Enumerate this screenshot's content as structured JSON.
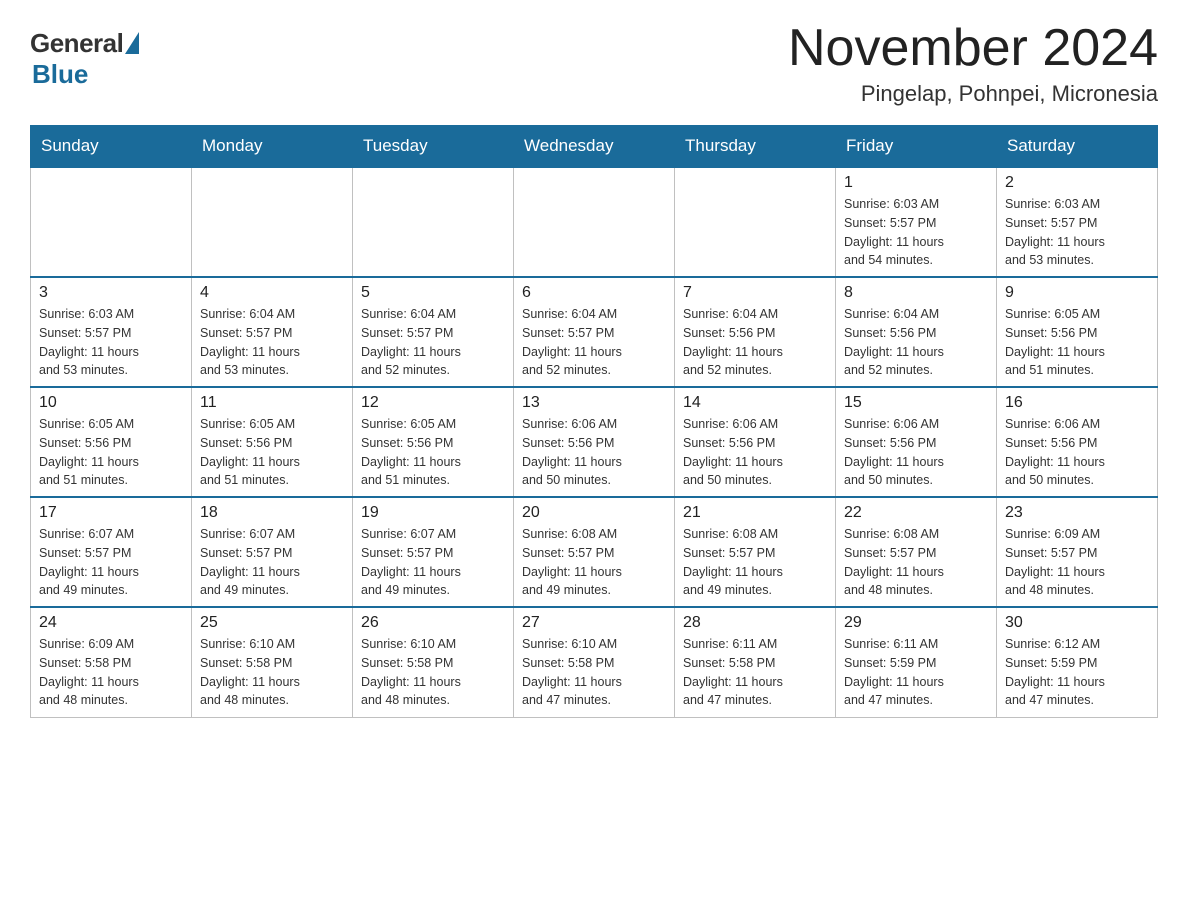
{
  "header": {
    "logo_general": "General",
    "logo_blue": "Blue",
    "month_title": "November 2024",
    "location": "Pingelap, Pohnpei, Micronesia"
  },
  "days_of_week": [
    "Sunday",
    "Monday",
    "Tuesday",
    "Wednesday",
    "Thursday",
    "Friday",
    "Saturday"
  ],
  "weeks": [
    [
      {
        "day": "",
        "info": ""
      },
      {
        "day": "",
        "info": ""
      },
      {
        "day": "",
        "info": ""
      },
      {
        "day": "",
        "info": ""
      },
      {
        "day": "",
        "info": ""
      },
      {
        "day": "1",
        "info": "Sunrise: 6:03 AM\nSunset: 5:57 PM\nDaylight: 11 hours\nand 54 minutes."
      },
      {
        "day": "2",
        "info": "Sunrise: 6:03 AM\nSunset: 5:57 PM\nDaylight: 11 hours\nand 53 minutes."
      }
    ],
    [
      {
        "day": "3",
        "info": "Sunrise: 6:03 AM\nSunset: 5:57 PM\nDaylight: 11 hours\nand 53 minutes."
      },
      {
        "day": "4",
        "info": "Sunrise: 6:04 AM\nSunset: 5:57 PM\nDaylight: 11 hours\nand 53 minutes."
      },
      {
        "day": "5",
        "info": "Sunrise: 6:04 AM\nSunset: 5:57 PM\nDaylight: 11 hours\nand 52 minutes."
      },
      {
        "day": "6",
        "info": "Sunrise: 6:04 AM\nSunset: 5:57 PM\nDaylight: 11 hours\nand 52 minutes."
      },
      {
        "day": "7",
        "info": "Sunrise: 6:04 AM\nSunset: 5:56 PM\nDaylight: 11 hours\nand 52 minutes."
      },
      {
        "day": "8",
        "info": "Sunrise: 6:04 AM\nSunset: 5:56 PM\nDaylight: 11 hours\nand 52 minutes."
      },
      {
        "day": "9",
        "info": "Sunrise: 6:05 AM\nSunset: 5:56 PM\nDaylight: 11 hours\nand 51 minutes."
      }
    ],
    [
      {
        "day": "10",
        "info": "Sunrise: 6:05 AM\nSunset: 5:56 PM\nDaylight: 11 hours\nand 51 minutes."
      },
      {
        "day": "11",
        "info": "Sunrise: 6:05 AM\nSunset: 5:56 PM\nDaylight: 11 hours\nand 51 minutes."
      },
      {
        "day": "12",
        "info": "Sunrise: 6:05 AM\nSunset: 5:56 PM\nDaylight: 11 hours\nand 51 minutes."
      },
      {
        "day": "13",
        "info": "Sunrise: 6:06 AM\nSunset: 5:56 PM\nDaylight: 11 hours\nand 50 minutes."
      },
      {
        "day": "14",
        "info": "Sunrise: 6:06 AM\nSunset: 5:56 PM\nDaylight: 11 hours\nand 50 minutes."
      },
      {
        "day": "15",
        "info": "Sunrise: 6:06 AM\nSunset: 5:56 PM\nDaylight: 11 hours\nand 50 minutes."
      },
      {
        "day": "16",
        "info": "Sunrise: 6:06 AM\nSunset: 5:56 PM\nDaylight: 11 hours\nand 50 minutes."
      }
    ],
    [
      {
        "day": "17",
        "info": "Sunrise: 6:07 AM\nSunset: 5:57 PM\nDaylight: 11 hours\nand 49 minutes."
      },
      {
        "day": "18",
        "info": "Sunrise: 6:07 AM\nSunset: 5:57 PM\nDaylight: 11 hours\nand 49 minutes."
      },
      {
        "day": "19",
        "info": "Sunrise: 6:07 AM\nSunset: 5:57 PM\nDaylight: 11 hours\nand 49 minutes."
      },
      {
        "day": "20",
        "info": "Sunrise: 6:08 AM\nSunset: 5:57 PM\nDaylight: 11 hours\nand 49 minutes."
      },
      {
        "day": "21",
        "info": "Sunrise: 6:08 AM\nSunset: 5:57 PM\nDaylight: 11 hours\nand 49 minutes."
      },
      {
        "day": "22",
        "info": "Sunrise: 6:08 AM\nSunset: 5:57 PM\nDaylight: 11 hours\nand 48 minutes."
      },
      {
        "day": "23",
        "info": "Sunrise: 6:09 AM\nSunset: 5:57 PM\nDaylight: 11 hours\nand 48 minutes."
      }
    ],
    [
      {
        "day": "24",
        "info": "Sunrise: 6:09 AM\nSunset: 5:58 PM\nDaylight: 11 hours\nand 48 minutes."
      },
      {
        "day": "25",
        "info": "Sunrise: 6:10 AM\nSunset: 5:58 PM\nDaylight: 11 hours\nand 48 minutes."
      },
      {
        "day": "26",
        "info": "Sunrise: 6:10 AM\nSunset: 5:58 PM\nDaylight: 11 hours\nand 48 minutes."
      },
      {
        "day": "27",
        "info": "Sunrise: 6:10 AM\nSunset: 5:58 PM\nDaylight: 11 hours\nand 47 minutes."
      },
      {
        "day": "28",
        "info": "Sunrise: 6:11 AM\nSunset: 5:58 PM\nDaylight: 11 hours\nand 47 minutes."
      },
      {
        "day": "29",
        "info": "Sunrise: 6:11 AM\nSunset: 5:59 PM\nDaylight: 11 hours\nand 47 minutes."
      },
      {
        "day": "30",
        "info": "Sunrise: 6:12 AM\nSunset: 5:59 PM\nDaylight: 11 hours\nand 47 minutes."
      }
    ]
  ]
}
